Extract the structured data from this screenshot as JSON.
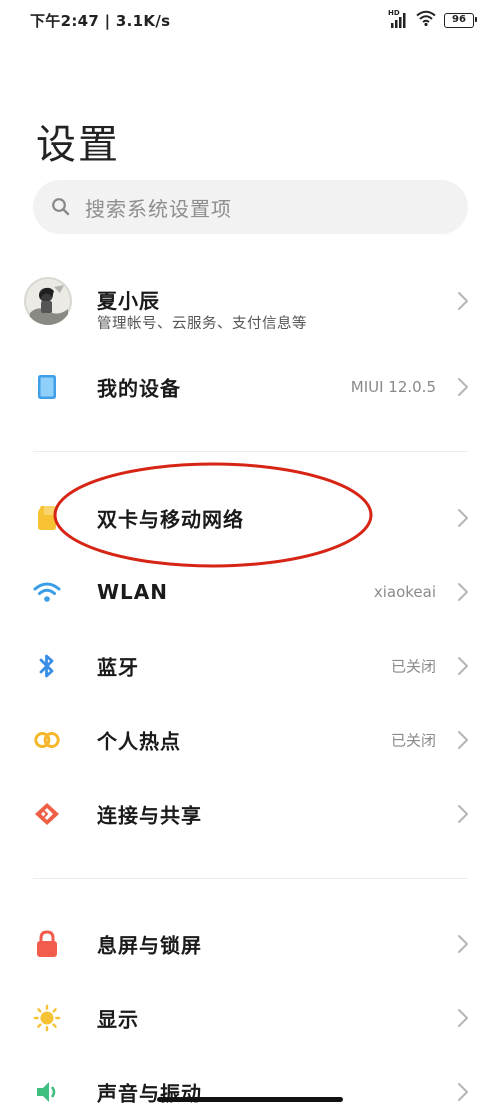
{
  "status_bar": {
    "left_text": "下午2:47 | 3.1K/s",
    "battery_level": "96",
    "signal_label": "HD"
  },
  "page_title": "设置",
  "search": {
    "placeholder": "搜索系统设置项",
    "icon": "search-icon"
  },
  "profile": {
    "name": "夏小辰",
    "subtitle": "管理帐号、云服务、支付信息等"
  },
  "sections": [
    {
      "items": [
        {
          "label": "我的设备",
          "value": "MIUI 12.0.5",
          "icon": "phone-icon",
          "color": "#3fa0e8"
        }
      ]
    },
    {
      "items": [
        {
          "label": "双卡与移动网络",
          "value": "",
          "icon": "sim-card-icon",
          "color": "#f7c234"
        },
        {
          "label": "WLAN",
          "value": "xiaokeai",
          "icon": "wifi-icon",
          "color": "#3a9de6"
        },
        {
          "label": "蓝牙",
          "value": "已关闭",
          "icon": "bluetooth-icon",
          "color": "#3a8ee6"
        },
        {
          "label": "个人热点",
          "value": "已关闭",
          "icon": "hotspot-icon",
          "color": "#f5b82a"
        },
        {
          "label": "连接与共享",
          "value": "",
          "icon": "share-icon",
          "color": "#ef5f45"
        }
      ]
    },
    {
      "items": [
        {
          "label": "息屏与锁屏",
          "value": "",
          "icon": "lock-icon",
          "color": "#f25c4d"
        },
        {
          "label": "显示",
          "value": "",
          "icon": "brightness-icon",
          "color": "#f7c234"
        },
        {
          "label": "声音与振动",
          "value": "",
          "icon": "sound-icon",
          "color": "#3fbf7f"
        }
      ]
    }
  ],
  "colors": {
    "annotation": "#d62415",
    "chevron": "#b5b5b5"
  }
}
